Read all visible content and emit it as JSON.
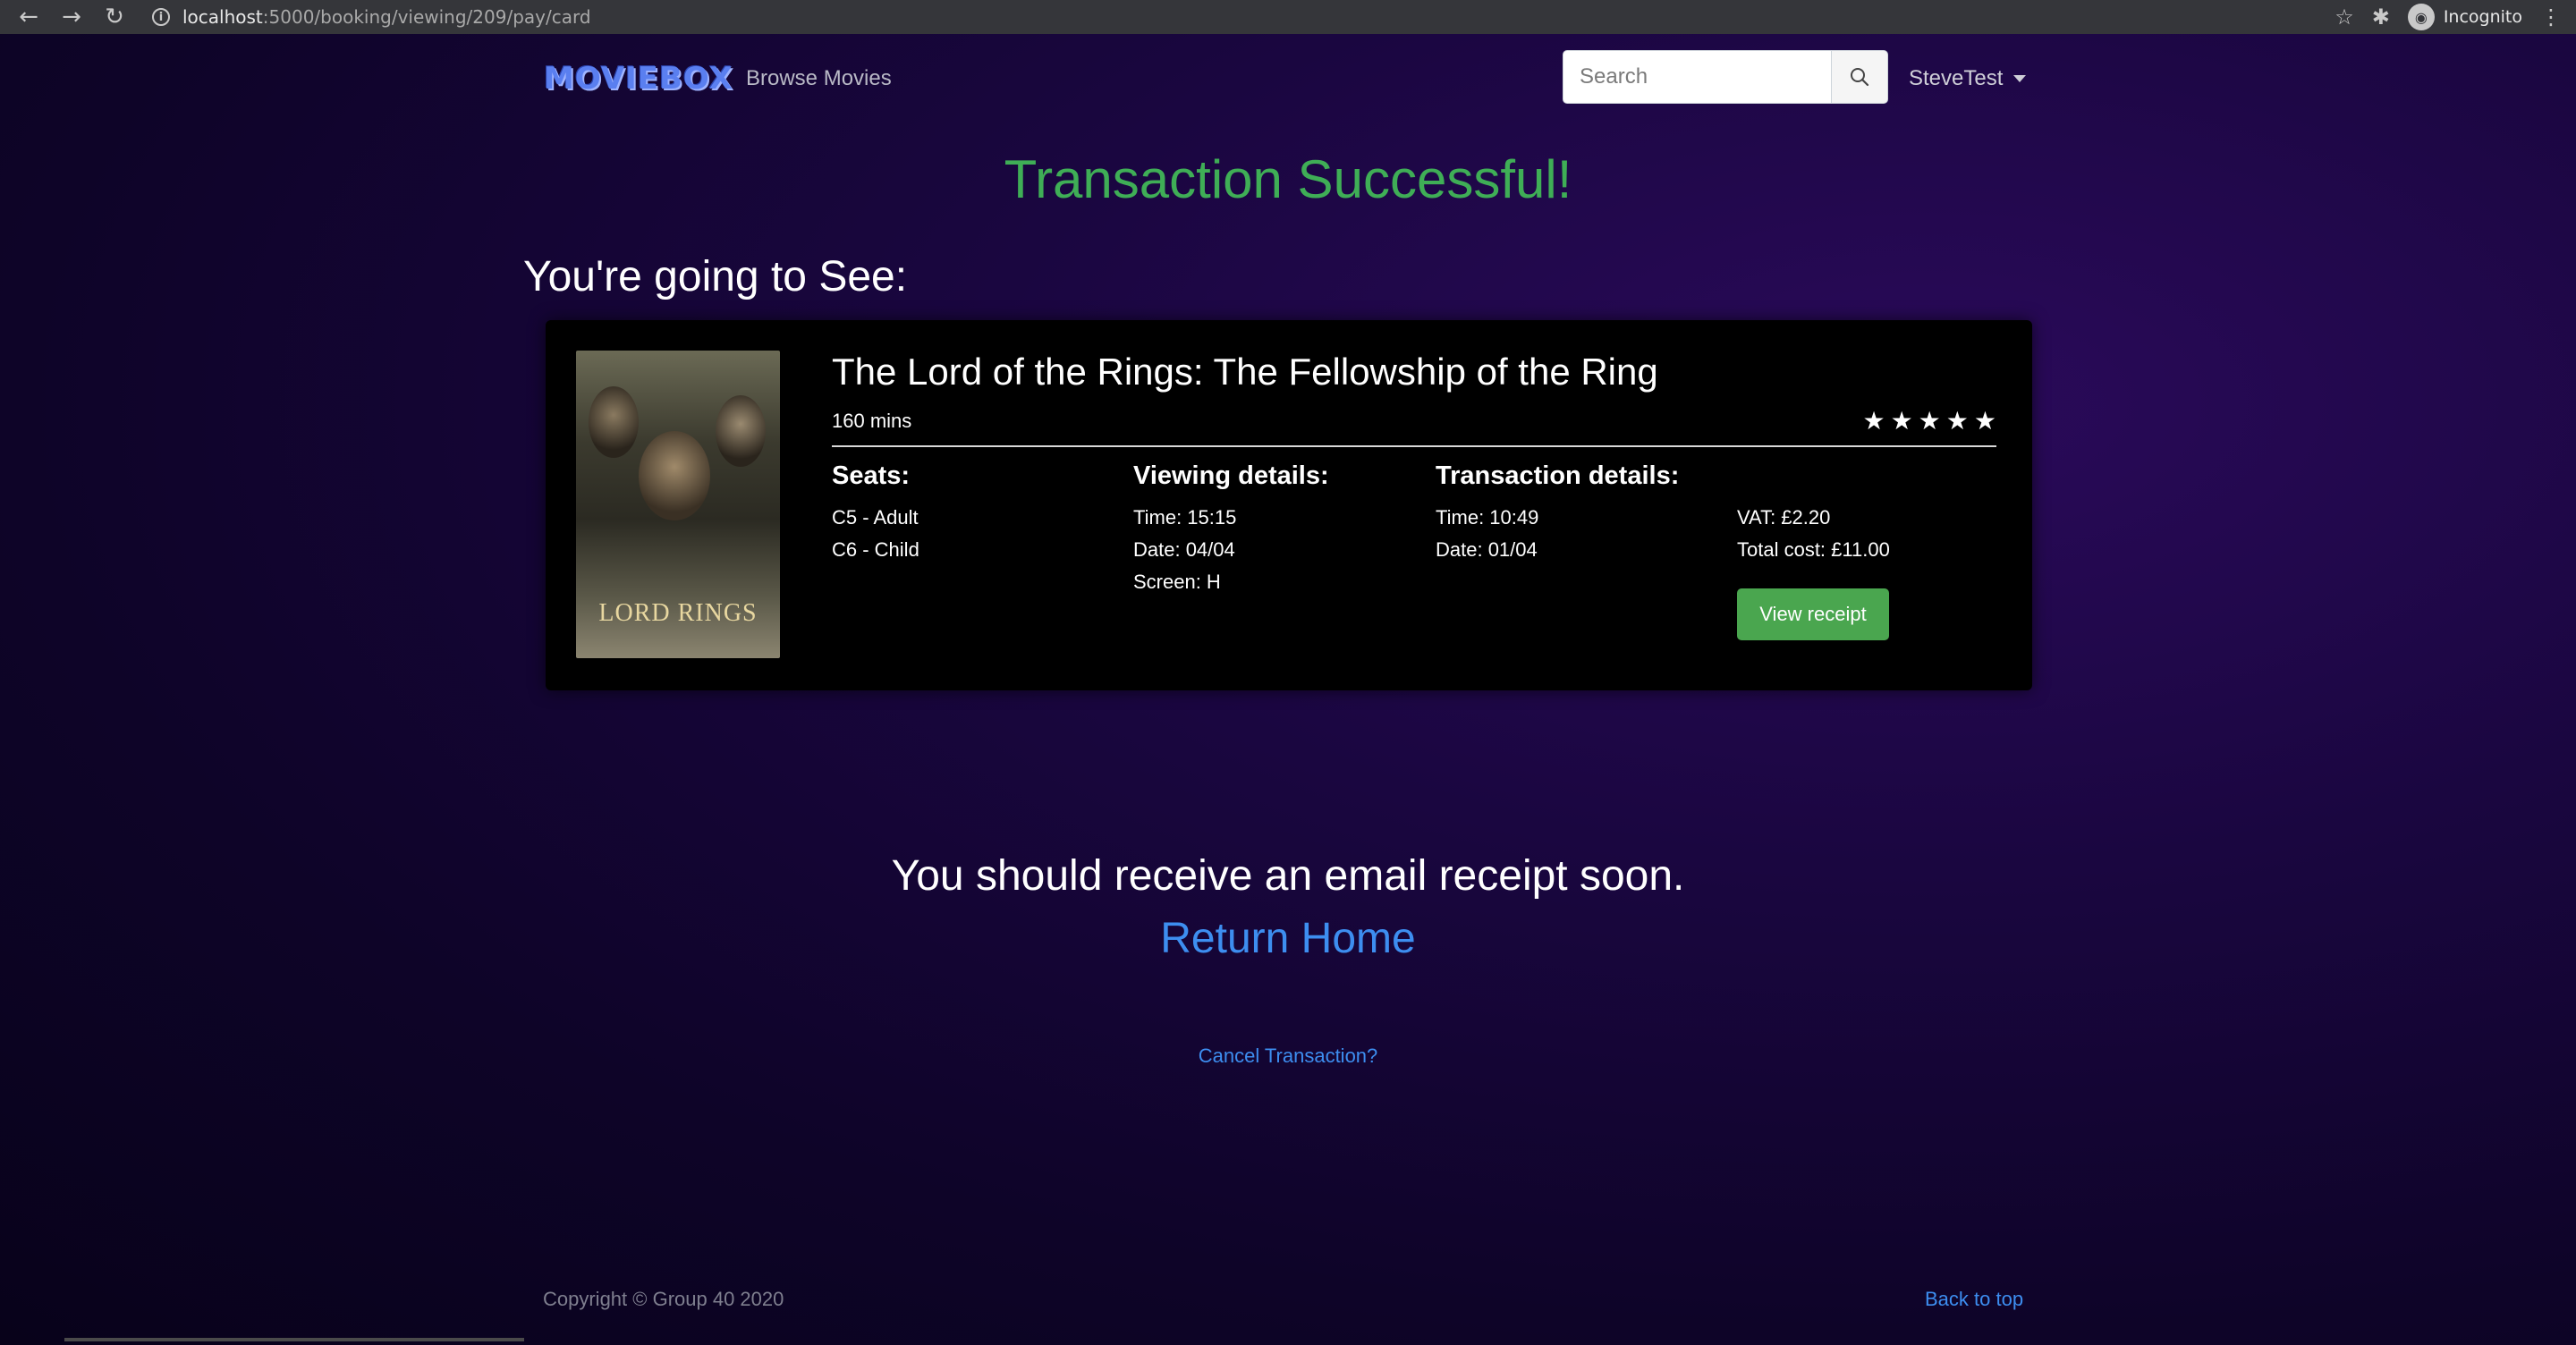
{
  "browser": {
    "url_host": "localhost",
    "url_path": ":5000/booking/viewing/209/pay/card",
    "profile_label": "Incognito"
  },
  "navbar": {
    "brand": "MOVIEBOX",
    "browse_link": "Browse Movies",
    "search_placeholder": "Search",
    "user_name": "SteveTest"
  },
  "main": {
    "success_title": "Transaction Successful!",
    "going_title": "You're going to See:",
    "movie": {
      "title": "The Lord of the Rings: The Fellowship of the Ring",
      "runtime": "160 mins",
      "rating_stars": 5,
      "poster_text": "LORD RINGS"
    },
    "seats": {
      "heading": "Seats:",
      "items": [
        "C5 - Adult",
        "C6 - Child"
      ]
    },
    "viewing": {
      "heading": "Viewing details:",
      "time": "Time: 15:15",
      "date": "Date: 04/04",
      "screen": "Screen: H"
    },
    "transaction": {
      "heading": "Transaction details:",
      "time": "Time: 10:49",
      "date": "Date: 01/04",
      "vat": "VAT: £2.20",
      "total": "Total cost: £11.00"
    },
    "receipt_button": "View receipt",
    "email_message": "You should receive an email receipt soon.",
    "return_home": "Return Home",
    "cancel_link": "Cancel Transaction?"
  },
  "footer": {
    "copyright": "Copyright © Group 40 2020",
    "back_to_top": "Back to top"
  },
  "colors": {
    "success_green": "#3fae56",
    "link_blue": "#3d8ef0",
    "button_green": "#4aa64f",
    "brand_blue": "#5a7ff0"
  }
}
